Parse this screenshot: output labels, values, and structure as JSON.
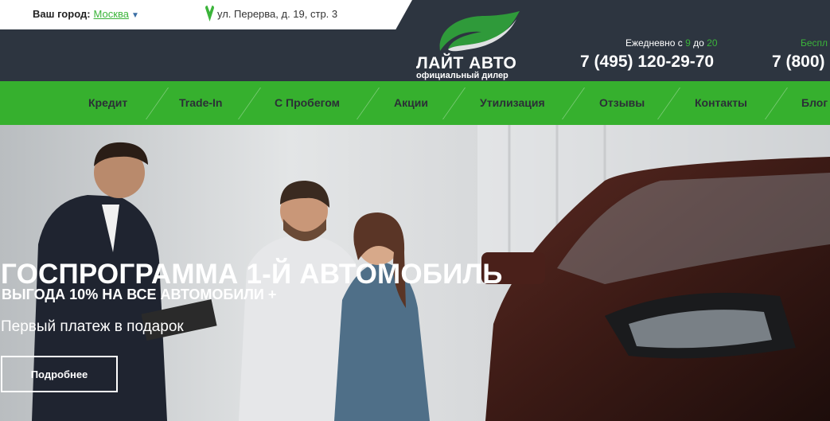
{
  "top": {
    "city_label": "Ваш город:",
    "city_value": "Москва",
    "address": "ул. Перерва, д. 19, стр. 3"
  },
  "logo": {
    "name": "ЛАЙТ АВТО",
    "sub": "официальный дилер"
  },
  "contacts": {
    "hours_prefix": "Ежедневно с",
    "hours_from": "9",
    "hours_mid": "до",
    "hours_to": "20",
    "phone1": "7 (495) 120-29-70",
    "free_label": "Беспл",
    "phone2": "7 (800)"
  },
  "nav": {
    "items": [
      "Кредит",
      "Trade-In",
      "С Пробегом",
      "Акции",
      "Утилизация",
      "Отзывы",
      "Контакты",
      "Блог"
    ]
  },
  "hero": {
    "title": "ГОСПРОГРАММА 1-Й АВТОМОБИЛЬ",
    "subtitle": "ВЫГОДА 10% НА ВСЕ АВТОМОБИЛИ +",
    "text": "Первый платеж в подарок",
    "button": "Подробнее"
  },
  "colors": {
    "brand_green": "#36b02e",
    "header_dark": "#2d3540"
  },
  "icons": {
    "location": "location-pin-icon",
    "dropdown": "caret-down-icon",
    "logo_leaf": "leaf-logo-icon"
  }
}
